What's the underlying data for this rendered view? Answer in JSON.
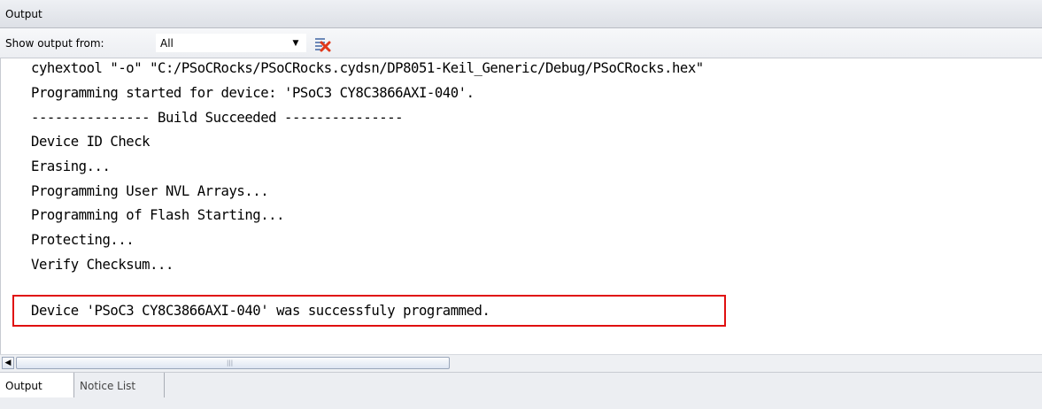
{
  "panel": {
    "title": "Output"
  },
  "toolbar": {
    "show_output_label": "Show output from:",
    "source_value": "All",
    "dropdown_arrow": "▼",
    "clear_icon": "clear-all-icon"
  },
  "output": {
    "lines": [
      "cyhextool \"-o\" \"C:/PSoCRocks/PSoCRocks.cydsn/DP8051-Keil_Generic/Debug/PSoCRocks.hex\"",
      "Programming started for device: 'PSoC3 CY8C3866AXI-040'.",
      "--------------- Build Succeeded ---------------",
      "Device ID Check",
      "Erasing...",
      "Programming User NVL Arrays...",
      "Programming of Flash Starting...",
      "Protecting...",
      "Verify Checksum...",
      "Device 'PSoC3 CY8C3866AXI-040' was successfuly programmed."
    ],
    "highlighted_line_index": 9,
    "highlight_color": "#e01010"
  },
  "scrollbar": {
    "left_arrow": "◀",
    "grip": "|||"
  },
  "tabs": [
    {
      "label": "Output",
      "active": true
    },
    {
      "label": "Notice List",
      "active": false
    }
  ]
}
